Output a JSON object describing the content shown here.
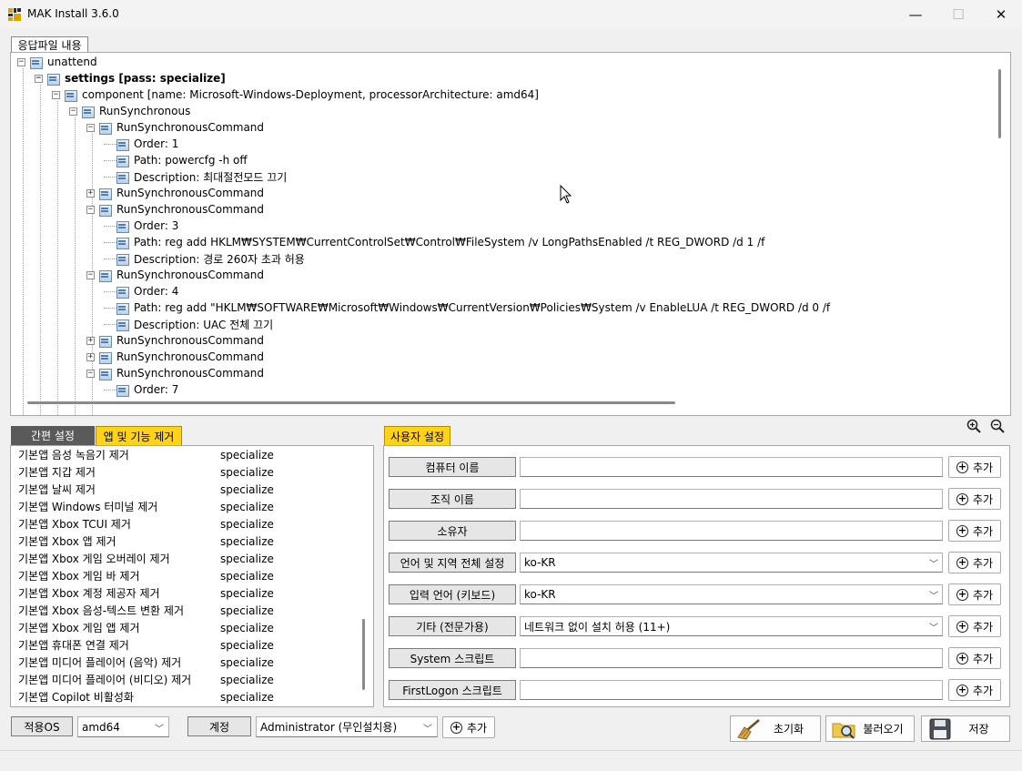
{
  "window": {
    "title": "MAK Install 3.6.0",
    "minimize": "—",
    "maximize": "☐",
    "close": "✕"
  },
  "tree": {
    "tab_label": "응답파일 내용",
    "nodes": [
      {
        "text": "unattend",
        "level": 0,
        "exp": "−",
        "bold": false
      },
      {
        "text": "settings [pass: specialize]",
        "level": 1,
        "exp": "−",
        "bold": true
      },
      {
        "text": "component [name: Microsoft-Windows-Deployment, processorArchitecture: amd64]",
        "level": 2,
        "exp": "−",
        "bold": false
      },
      {
        "text": "RunSynchronous",
        "level": 3,
        "exp": "−",
        "bold": false
      },
      {
        "text": "RunSynchronousCommand",
        "level": 4,
        "exp": "−",
        "bold": false
      },
      {
        "text": "Order: 1",
        "level": 5,
        "exp": "",
        "bold": false
      },
      {
        "text": "Path: powercfg -h off",
        "level": 5,
        "exp": "",
        "bold": false
      },
      {
        "text": "Description: 최대절전모드 끄기",
        "level": 5,
        "exp": "",
        "bold": false
      },
      {
        "text": "RunSynchronousCommand",
        "level": 4,
        "exp": "+",
        "bold": false
      },
      {
        "text": "RunSynchronousCommand",
        "level": 4,
        "exp": "−",
        "bold": false
      },
      {
        "text": "Order: 3",
        "level": 5,
        "exp": "",
        "bold": false
      },
      {
        "text": "Path: reg add HKLM₩SYSTEM₩CurrentControlSet₩Control₩FileSystem /v LongPathsEnabled /t REG_DWORD /d 1 /f",
        "level": 5,
        "exp": "",
        "bold": false
      },
      {
        "text": "Description: 경로 260자 초과 허용",
        "level": 5,
        "exp": "",
        "bold": false
      },
      {
        "text": "RunSynchronousCommand",
        "level": 4,
        "exp": "−",
        "bold": false
      },
      {
        "text": "Order: 4",
        "level": 5,
        "exp": "",
        "bold": false
      },
      {
        "text": "Path: reg add \"HKLM₩SOFTWARE₩Microsoft₩Windows₩CurrentVersion₩Policies₩System /v EnableLUA /t REG_DWORD /d 0 /f",
        "level": 5,
        "exp": "",
        "bold": false
      },
      {
        "text": "Description: UAC 전체 끄기",
        "level": 5,
        "exp": "",
        "bold": false
      },
      {
        "text": "RunSynchronousCommand",
        "level": 4,
        "exp": "+",
        "bold": false
      },
      {
        "text": "RunSynchronousCommand",
        "level": 4,
        "exp": "+",
        "bold": false
      },
      {
        "text": "RunSynchronousCommand",
        "level": 4,
        "exp": "−",
        "bold": false
      },
      {
        "text": "Order: 7",
        "level": 5,
        "exp": "",
        "bold": false
      }
    ]
  },
  "left_tabs": {
    "simple": "간편 설정",
    "apps": "앱 및 기능 제거"
  },
  "app_list": [
    {
      "name": "기본앱 음성 녹음기 제거",
      "pass": "specialize"
    },
    {
      "name": "기본앱 지갑 제거",
      "pass": "specialize"
    },
    {
      "name": "기본앱 날씨 제거",
      "pass": "specialize"
    },
    {
      "name": "기본앱 Windows 터미널 제거",
      "pass": "specialize"
    },
    {
      "name": "기본앱 Xbox TCUI 제거",
      "pass": "specialize"
    },
    {
      "name": "기본앱 Xbox 앱 제거",
      "pass": "specialize"
    },
    {
      "name": "기본앱 Xbox 게임 오버레이 제거",
      "pass": "specialize"
    },
    {
      "name": "기본앱 Xbox 게임 바 제거",
      "pass": "specialize"
    },
    {
      "name": "기본앱 Xbox 계정 제공자 제거",
      "pass": "specialize"
    },
    {
      "name": "기본앱 Xbox 음성-텍스트 변환 제거",
      "pass": "specialize"
    },
    {
      "name": "기본앱 Xbox 게임 앱 제거",
      "pass": "specialize"
    },
    {
      "name": "기본앱 휴대폰 연결 제거",
      "pass": "specialize"
    },
    {
      "name": "기본앱 미디어 플레이어 (음악) 제거",
      "pass": "specialize"
    },
    {
      "name": "기본앱 미디어 플레이어 (비디오) 제거",
      "pass": "specialize"
    },
    {
      "name": "기본앱 Copilot 비활성화",
      "pass": "specialize"
    }
  ],
  "user_settings": {
    "tab_label": "사용자 설정",
    "add_label": "추가",
    "rows": [
      {
        "label": "컴퓨터 이름",
        "value": "",
        "dropdown": false
      },
      {
        "label": "조직 이름",
        "value": "",
        "dropdown": false
      },
      {
        "label": "소유자",
        "value": "",
        "dropdown": false
      },
      {
        "label": "언어 및 지역 전체 설정",
        "value": "ko-KR",
        "dropdown": true
      },
      {
        "label": "입력 언어 (키보드)",
        "value": "ko-KR",
        "dropdown": true
      },
      {
        "label": "기타 (전문가용)",
        "value": "네트워크 없이 설치 허용 (11+)",
        "dropdown": true
      },
      {
        "label": "System 스크립트",
        "value": "",
        "dropdown": false
      },
      {
        "label": "FirstLogon 스크립트",
        "value": "",
        "dropdown": false
      }
    ]
  },
  "bottom": {
    "os_label": "적용OS",
    "os_value": "amd64",
    "account_label": "계정",
    "account_value": "Administrator (무인설치용)",
    "add_label": "추가",
    "reset_label": "초기화",
    "load_label": "불러오기",
    "save_label": "저장"
  },
  "colors": {
    "accent_yellow": "#ffd31a",
    "tab_dark": "#5a5a5a"
  }
}
